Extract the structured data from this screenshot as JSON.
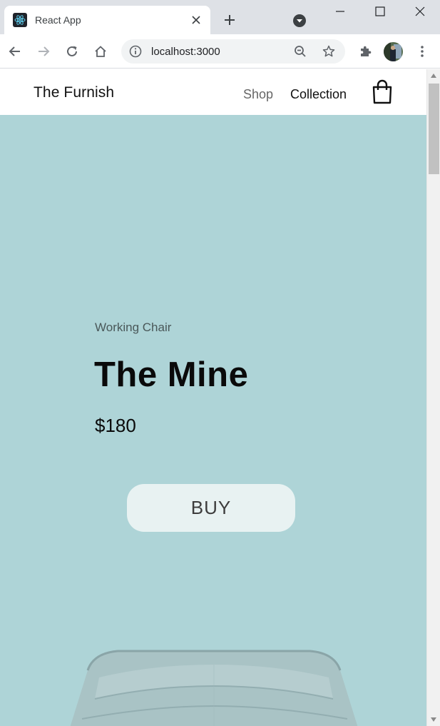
{
  "browser": {
    "tab": {
      "title": "React App",
      "favicon": "react-logo-icon",
      "close_icon": "close-icon"
    },
    "new_tab_icon": "plus-icon",
    "tab_search_icon": "chevron-down-circle-icon",
    "window_controls": [
      "minimize-icon",
      "maximize-icon",
      "close-icon"
    ],
    "nav": {
      "back_icon": "back-arrow-icon",
      "forward_icon": "forward-arrow-icon",
      "reload_icon": "reload-icon",
      "home_icon": "home-icon"
    },
    "omnibox": {
      "url": "localhost:3000",
      "info_icon": "info-icon",
      "zoom_icon": "zoom-out-icon",
      "bookmark_icon": "star-icon"
    },
    "extensions_icon": "puzzle-icon",
    "menu_icon": "kebab-menu-icon"
  },
  "site": {
    "brand": "The Furnish",
    "nav": {
      "shop": "Shop",
      "collection": "Collection"
    },
    "cart_icon": "shopping-bag-icon"
  },
  "hero": {
    "category": "Working Chair",
    "title": "The Mine",
    "price": "$180",
    "buy_label": "BUY",
    "image": "chair-image"
  },
  "colors": {
    "hero_bg": "#aed4d7",
    "buy_bg": "#e8f2f2",
    "chrome_bg": "#dee1e6",
    "nav_muted": "#666666"
  }
}
